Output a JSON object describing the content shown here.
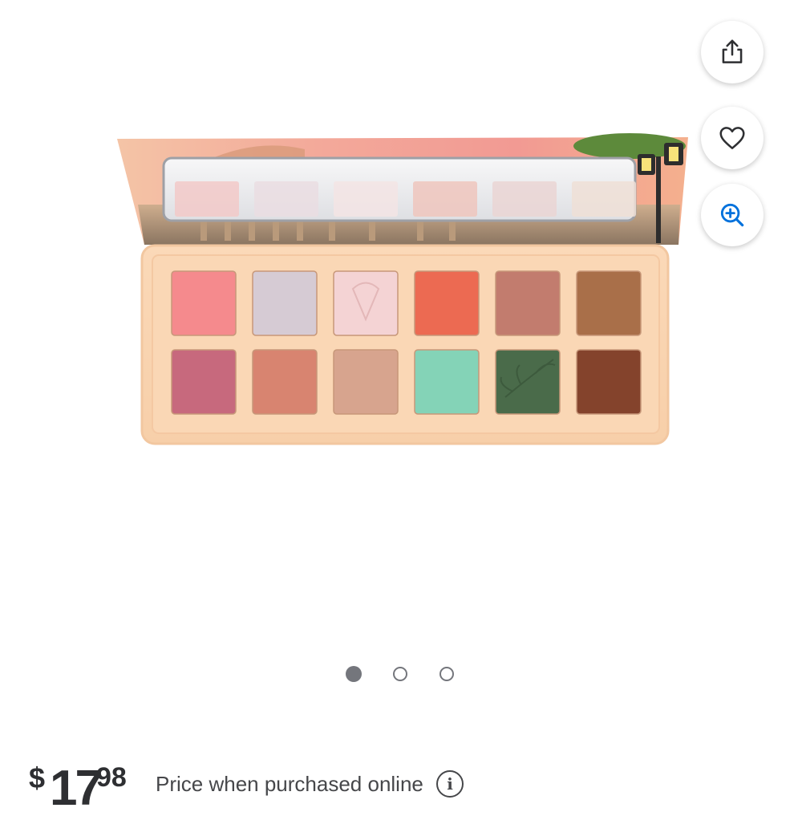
{
  "actions": {
    "share_icon": "share-icon",
    "favorite_icon": "heart-icon",
    "zoom_icon": "zoom-in-icon",
    "accent_color": "#0071dc"
  },
  "product_image": {
    "swatch_colors_top": [
      "#f58a8d",
      "#d6cbd4",
      "#f4d3d4",
      "#ec6a52",
      "#c27c6e",
      "#a96f49"
    ],
    "swatch_colors_bottom": [
      "#c7697d",
      "#d88470",
      "#d7a48e",
      "#84d3b7",
      "#4a6b4a",
      "#84432c"
    ],
    "mirror_colors": [
      "#f2c9c8",
      "#eadde2",
      "#f3e4e4",
      "#efc6bd",
      "#ead5d3",
      "#efdfd6"
    ]
  },
  "carousel": {
    "total": 3,
    "active_index": 0
  },
  "price": {
    "symbol": "$",
    "dollars": "17",
    "cents": "98",
    "note": "Price when purchased online",
    "info_icon": "info-icon",
    "info_glyph": "i"
  }
}
